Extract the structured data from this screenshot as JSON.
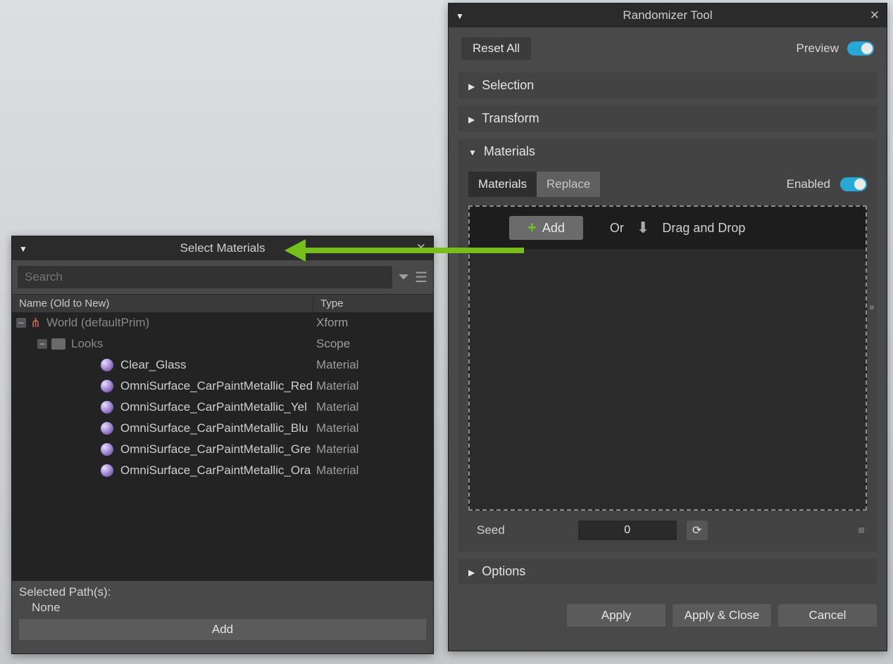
{
  "randomizer": {
    "title": "Randomizer Tool",
    "reset_label": "Reset All",
    "preview_label": "Preview",
    "preview_on": true,
    "sections": {
      "selection": {
        "label": "Selection"
      },
      "transform": {
        "label": "Transform"
      },
      "materials": {
        "label": "Materials",
        "tab_active": "Materials",
        "tab_inactive": "Replace",
        "enabled_label": "Enabled",
        "enabled_on": true,
        "add_label": "Add",
        "or_label": "Or",
        "dragdrop_label": "Drag and Drop",
        "seed_label": "Seed",
        "seed_value": "0"
      },
      "options": {
        "label": "Options"
      }
    },
    "footer": {
      "apply": "Apply",
      "apply_close": "Apply & Close",
      "cancel": "Cancel"
    }
  },
  "select_materials": {
    "title": "Select Materials",
    "search_placeholder": "Search",
    "col_name": "Name (Old to New)",
    "col_type": "Type",
    "rows": [
      {
        "depth": 0,
        "icon": "world",
        "name": "World (defaultPrim)",
        "type": "Xform",
        "dim": true,
        "expand": "minus"
      },
      {
        "depth": 1,
        "icon": "folder",
        "name": "Looks",
        "type": "Scope",
        "dim": true,
        "expand": "minus"
      },
      {
        "depth": 2,
        "icon": "ball",
        "name": "Clear_Glass",
        "type": "Material"
      },
      {
        "depth": 2,
        "icon": "ball",
        "name": "OmniSurface_CarPaintMetallic_Red",
        "type": "Material"
      },
      {
        "depth": 2,
        "icon": "ball",
        "name": "OmniSurface_CarPaintMetallic_Yel",
        "type": "Material"
      },
      {
        "depth": 2,
        "icon": "ball",
        "name": "OmniSurface_CarPaintMetallic_Blu",
        "type": "Material"
      },
      {
        "depth": 2,
        "icon": "ball",
        "name": "OmniSurface_CarPaintMetallic_Gre",
        "type": "Material"
      },
      {
        "depth": 2,
        "icon": "ball",
        "name": "OmniSurface_CarPaintMetallic_Ora",
        "type": "Material"
      }
    ],
    "selected_paths_label": "Selected Path(s):",
    "selected_paths_value": "None",
    "add_label": "Add"
  }
}
